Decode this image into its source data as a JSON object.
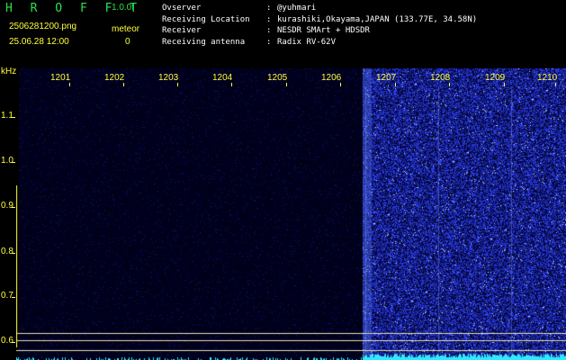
{
  "app": {
    "title": "H R O F F T",
    "version": "1.0.0f",
    "filename": "2506281200.png",
    "datetime": "25.06.28 12:00",
    "mode": "meteor",
    "count": "0"
  },
  "info": [
    {
      "label": "Ovserver",
      "sep": ":",
      "value": "@yuhmari"
    },
    {
      "label": "Receiving Location",
      "sep": ":",
      "value": "kurashiki,Okayama,JAPAN (133.77E, 34.58N)"
    },
    {
      "label": "Receiver",
      "sep": ":",
      "value": "NESDR SMArt + HDSDR"
    },
    {
      "label": "Receiving antenna",
      "sep": ":",
      "value": "Radix RV-62V"
    }
  ],
  "axis": {
    "unit": "kHz",
    "freq_labels": [
      "1201",
      "1202",
      "1203",
      "1204",
      "1205",
      "1206",
      "1207",
      "1208",
      "1209",
      "1210"
    ],
    "y_labels": [
      "1.1",
      "1.0",
      "0.9",
      "0.8",
      "0.7",
      "0.6"
    ]
  },
  "colors": {
    "header_green": "#2ce04a",
    "label_yellow": "#ffff3a",
    "noise_blue": "#2a3cff",
    "baseline_cyan": "#30e8ff",
    "guide_lines": "#e8e0b0"
  },
  "spectrogram": {
    "transmission_start_khz": 1206.4,
    "signal_lines_khz": [
      1206.45,
      1207.8,
      1209.15
    ]
  }
}
